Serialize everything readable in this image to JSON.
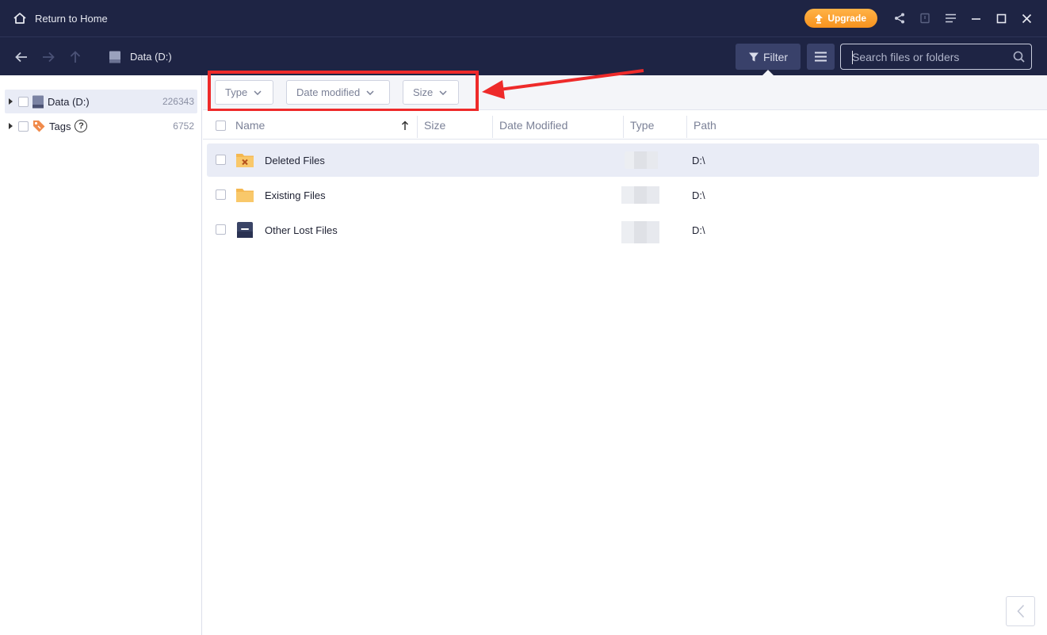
{
  "titlebar": {
    "home_label": "Return to Home",
    "upgrade_label": "Upgrade"
  },
  "toolbar": {
    "breadcrumb": "Data (D:)",
    "filter_label": "Filter",
    "search_placeholder": "Search files or folders"
  },
  "sidebar": {
    "items": [
      {
        "label": "Data (D:)",
        "count": "226343"
      },
      {
        "label": "Tags",
        "count": "6752"
      }
    ]
  },
  "filters": [
    {
      "label": "Type"
    },
    {
      "label": "Date modified"
    },
    {
      "label": "Size"
    }
  ],
  "table": {
    "columns": [
      "Name",
      "Size",
      "Date Modified",
      "Type",
      "Path"
    ],
    "rows": [
      {
        "name": "Deleted Files",
        "path": "D:\\"
      },
      {
        "name": "Existing Files",
        "path": "D:\\"
      },
      {
        "name": "Other Lost Files",
        "path": "D:\\"
      }
    ]
  },
  "colors": {
    "header_bg": "#1e2444",
    "accent_orange": "#f7921e",
    "annotation_red": "#ee2a2a"
  }
}
